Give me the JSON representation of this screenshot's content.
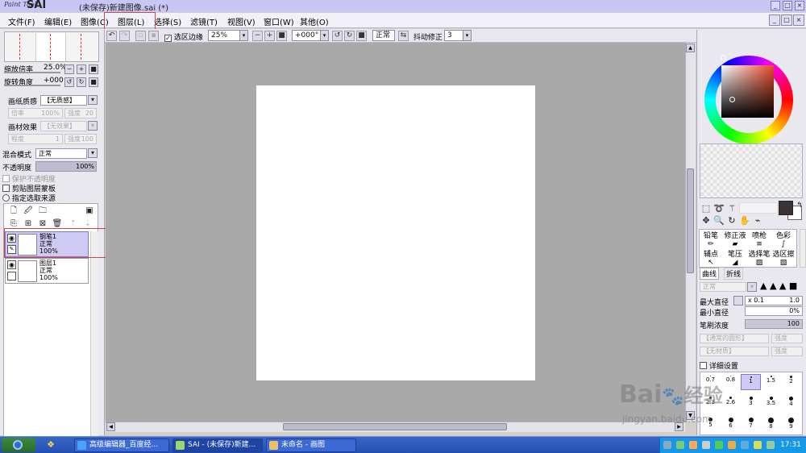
{
  "titlebar": {
    "logo_small": "Paint Tool",
    "logo_big": "SAI",
    "title": "(未保存)新建图像.sai (*)",
    "min": "_",
    "max": "□",
    "close": "×"
  },
  "menu": {
    "items": [
      "文件(F)",
      "编辑(E)",
      "图像(C)",
      "图层(L)",
      "选择(S)",
      "滤镜(T)",
      "视图(V)",
      "窗口(W)",
      "其他(O)"
    ],
    "highlighted": "图层(L)"
  },
  "toolbar": {
    "selection_edge_label": "选区边缘",
    "selection_edge_checked": true,
    "zoom_value": "25%",
    "rotate_value": "+000°",
    "blend_value": "正常",
    "stabilizer_label": "抖动修正",
    "stabilizer_value": "3"
  },
  "left_panel": {
    "zoom_label": "缩放倍率",
    "zoom_value": "25.0%",
    "rotate_label": "旋转角度",
    "rotate_value": "+000",
    "paper_texture_label": "画纸质感",
    "paper_texture_value": "【无质感】",
    "scale_label": "倍率",
    "scale_value": "100%",
    "strength_label": "强度",
    "strength_value": "20",
    "material_effect_label": "画材效果",
    "material_effect_value": "【无效果】",
    "degree_label": "程度",
    "degree_value": "1",
    "strength2_label": "强度",
    "strength2_value": "100",
    "blend_mode_label": "混合模式",
    "blend_mode_value": "正常",
    "opacity_label": "不透明度",
    "opacity_value": "100%",
    "opacity_fraction": 1.0,
    "protect_opacity": "保护不透明度",
    "clip_mask": "剪贴图层蒙板",
    "selection_source": "指定选取来源"
  },
  "layers": [
    {
      "name": "钢笔1",
      "mode": "正常",
      "opacity": "100%",
      "selected": true
    },
    {
      "name": "图层1",
      "mode": "正常",
      "opacity": "100%",
      "selected": false
    }
  ],
  "right_panel": {
    "brush_tools": [
      "铅笔",
      "修正液",
      "喷枪",
      "色彩",
      "辅点",
      "笔压",
      "选择笔",
      "选区擦"
    ],
    "brush_tabs": [
      "曲线",
      "折线"
    ],
    "normal_label": "正常",
    "max_diameter_label": "最大直径",
    "max_diameter_mult": "x 0.1",
    "max_diameter_value": "1.0",
    "min_diameter_label": "最小直径",
    "min_diameter_value": "0%",
    "density_label": "笔刷浓度",
    "density_value": "100",
    "shape_value": "【通常的圆形】",
    "shape_strength_label": "强度",
    "texture_value": "【无材质】",
    "texture_strength_label": "强度",
    "detail_label": "详细设置",
    "sizes": [
      "0.7",
      "0.8",
      "1",
      "1.5",
      "2",
      "2.3",
      "2.6",
      "3",
      "3.5",
      "4",
      "5",
      "6",
      "7",
      "8",
      "9"
    ],
    "selected_size": "1",
    "main_color": "#3b3232",
    "wheel_hue_color": "#e84a2a"
  },
  "taskbar": {
    "tasks": [
      "高级编辑器_百度经...",
      "SAI - (未保存)新建...",
      "未命名 - 画图"
    ],
    "active_index": 1,
    "clock": "17:31"
  },
  "watermark": {
    "text": "Bai",
    "text2": "经验",
    "url": "jingyan.baidu.com"
  }
}
